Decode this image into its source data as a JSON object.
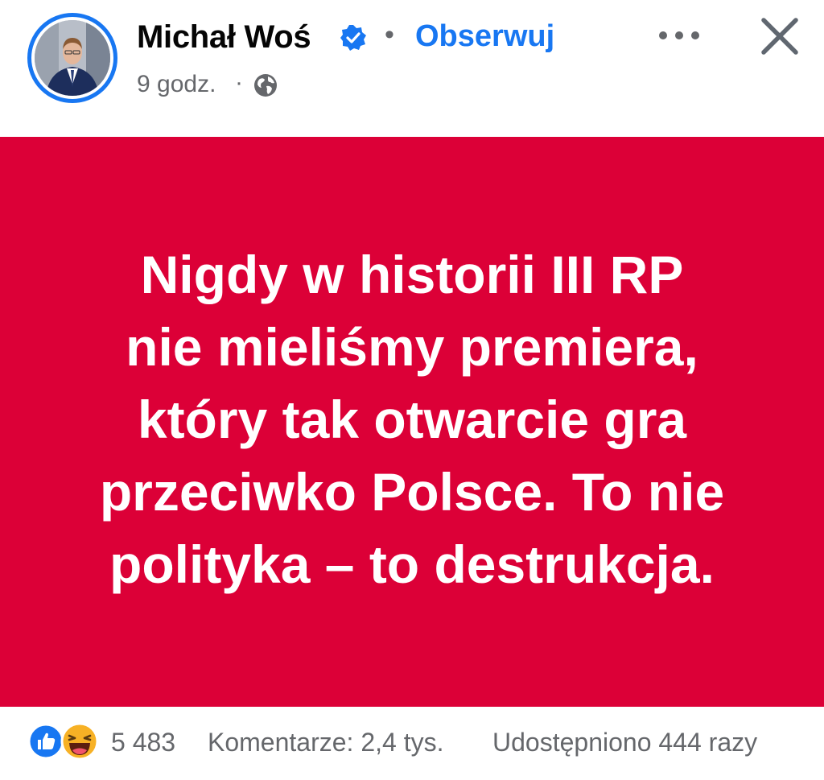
{
  "header": {
    "author_name": "Michał Woś",
    "separator": "•",
    "follow_label": "Obserwuj",
    "time": "9 godz.",
    "time_separator": "·",
    "icons": [
      "avatar",
      "verified-badge-icon",
      "globe-icon",
      "more-options-icon",
      "close-icon"
    ]
  },
  "post": {
    "text": "Nigdy w historii III RP\nnie mieliśmy premiera,\nktóry tak otwarcie gra\nprzeciwko Polsce. To nie\npolityka – to destrukcja.",
    "background_color": "#dc0037",
    "text_color": "#ffffff"
  },
  "footer": {
    "reaction_icons": [
      "like-icon",
      "haha-icon"
    ],
    "reaction_count": "5 483",
    "comments": "Komentarze: 2,4 tys.",
    "shares": "Udostępniono 444 razy"
  },
  "colors": {
    "accent": "#1877f2",
    "muted_text": "#65676b",
    "primary_text": "#050505"
  }
}
